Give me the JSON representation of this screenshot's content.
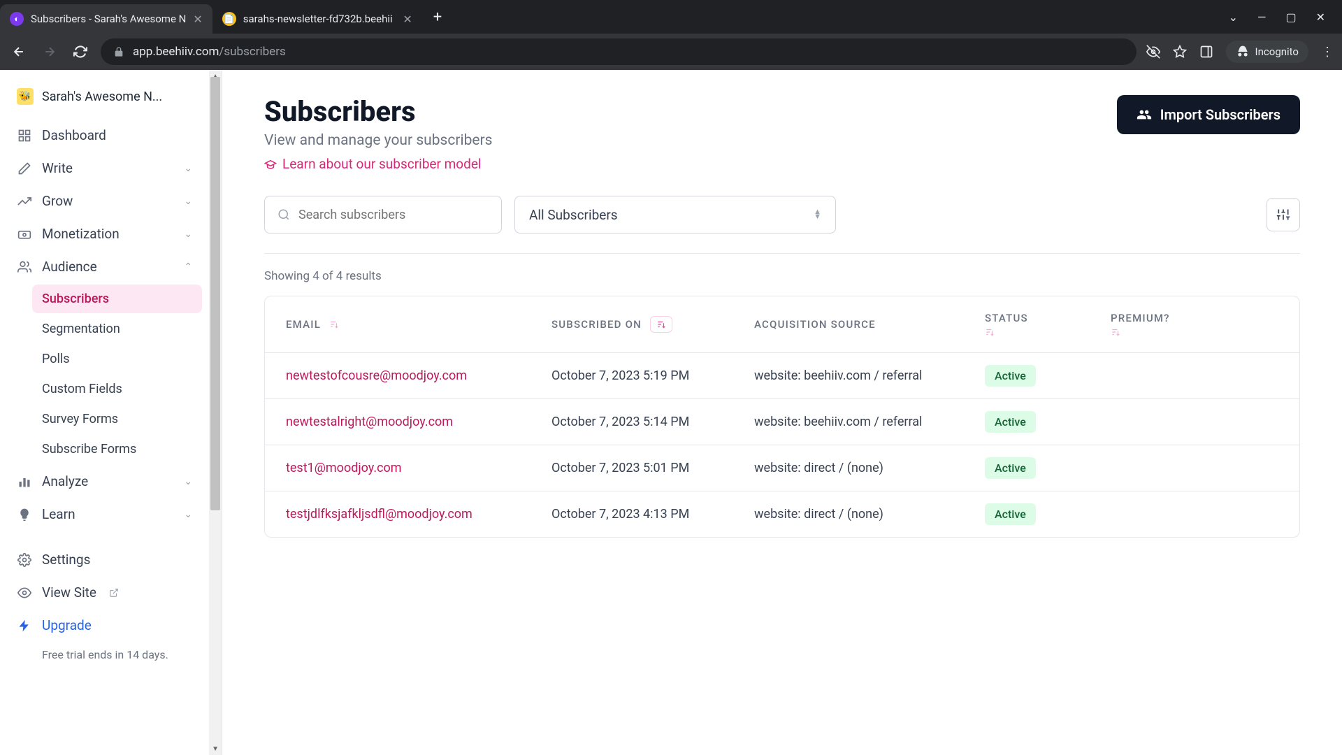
{
  "browser": {
    "tabs": [
      {
        "title": "Subscribers - Sarah's Awesome N",
        "favicon_bg": "#7c3aed",
        "favicon_text": "",
        "active": true
      },
      {
        "title": "sarahs-newsletter-fd732b.beehii",
        "favicon_bg": "#fbbf24",
        "favicon_text": "",
        "active": false
      }
    ],
    "url_domain": "app.beehiiv.com",
    "url_path": "/subscribers",
    "incognito_label": "Incognito"
  },
  "sidebar": {
    "workspace_name": "Sarah's Awesome N...",
    "items": [
      {
        "icon": "grid",
        "label": "Dashboard",
        "expandable": false
      },
      {
        "icon": "pencil",
        "label": "Write",
        "expandable": true
      },
      {
        "icon": "trend",
        "label": "Grow",
        "expandable": true
      },
      {
        "icon": "money",
        "label": "Monetization",
        "expandable": true
      },
      {
        "icon": "users",
        "label": "Audience",
        "expandable": true,
        "expanded": true,
        "children": [
          {
            "label": "Subscribers",
            "active": true
          },
          {
            "label": "Segmentation"
          },
          {
            "label": "Polls"
          },
          {
            "label": "Custom Fields"
          },
          {
            "label": "Survey Forms"
          },
          {
            "label": "Subscribe Forms"
          }
        ]
      },
      {
        "icon": "chart",
        "label": "Analyze",
        "expandable": true
      },
      {
        "icon": "bulb",
        "label": "Learn",
        "expandable": true
      }
    ],
    "bottom": [
      {
        "icon": "gear",
        "label": "Settings"
      },
      {
        "icon": "eye",
        "label": "View Site",
        "external": true
      },
      {
        "icon": "bolt",
        "label": "Upgrade",
        "highlight": true
      }
    ],
    "trial_note": "Free trial ends in 14 days."
  },
  "page": {
    "title": "Subscribers",
    "subtitle": "View and manage your subscribers",
    "learn_link": "Learn about our subscriber model",
    "import_button": "Import Subscribers",
    "search_placeholder": "Search subscribers",
    "segment_filter": "All Subscribers",
    "results_text": "Showing 4 of 4 results",
    "columns": {
      "email": "EMAIL",
      "subscribed_on": "SUBSCRIBED ON",
      "acquisition_source": "ACQUISITION SOURCE",
      "status": "STATUS",
      "premium": "PREMIUM?"
    },
    "rows": [
      {
        "email": "newtestofcousre@moodjoy.com",
        "date": "October 7, 2023 5:19 PM",
        "source": "website: beehiiv.com / referral",
        "status": "Active"
      },
      {
        "email": "newtestalright@moodjoy.com",
        "date": "October 7, 2023 5:14 PM",
        "source": "website: beehiiv.com / referral",
        "status": "Active"
      },
      {
        "email": "test1@moodjoy.com",
        "date": "October 7, 2023 5:01 PM",
        "source": "website: direct / (none)",
        "status": "Active"
      },
      {
        "email": "testjdlfksjafkljsdfl@moodjoy.com",
        "date": "October 7, 2023 4:13 PM",
        "source": "website: direct / (none)",
        "status": "Active"
      }
    ]
  }
}
